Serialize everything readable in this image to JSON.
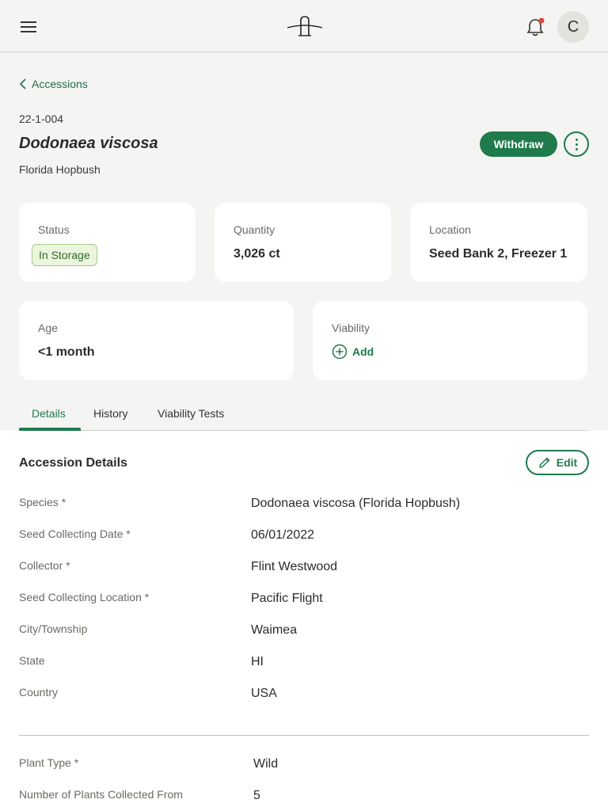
{
  "header": {
    "menu_icon": "hamburger-menu-icon",
    "logo_icon": "terraware-logo",
    "bell_icon": "notification-bell-icon",
    "notification_dot_color": "#e04a3a",
    "avatar_initial": "C"
  },
  "breadcrumb": {
    "label": "Accessions",
    "icon": "chevron-left-icon"
  },
  "accession": {
    "id": "22-1-004",
    "species": "Dodonaea viscosa",
    "common_name": "Florida Hopbush",
    "withdraw_label": "Withdraw",
    "more_icon": "vertical-dots-icon"
  },
  "cards": {
    "status": {
      "label": "Status",
      "value": "In Storage"
    },
    "quantity": {
      "label": "Quantity",
      "value": "3,026 ct"
    },
    "location": {
      "label": "Location",
      "value": "Seed Bank 2, Freezer 1"
    },
    "age": {
      "label": "Age",
      "value": "<1 month"
    },
    "viability": {
      "label": "Viability",
      "add_label": "Add",
      "add_icon": "plus-circle-icon"
    }
  },
  "tabs": [
    {
      "label": "Details",
      "active": true
    },
    {
      "label": "History",
      "active": false
    },
    {
      "label": "Viability Tests",
      "active": false
    }
  ],
  "details": {
    "title": "Accession Details",
    "edit_label": "Edit",
    "edit_icon": "pencil-icon",
    "fields": [
      {
        "label": "Species *",
        "value": "Dodonaea viscosa (Florida Hopbush)"
      },
      {
        "label": "Seed Collecting Date *",
        "value": "06/01/2022"
      },
      {
        "label": "Collector *",
        "value": "Flint Westwood"
      },
      {
        "label": "Seed Collecting Location *",
        "value": "Pacific Flight"
      },
      {
        "label": "City/Township",
        "value": "Waimea"
      },
      {
        "label": "State",
        "value": "HI"
      },
      {
        "label": "Country",
        "value": "USA"
      }
    ],
    "fields2": [
      {
        "label": "Plant Type *",
        "value": "Wild"
      },
      {
        "label": "Number of Plants Collected From",
        "value": "5"
      }
    ]
  },
  "colors": {
    "brand": "#1f7a4c",
    "background": "#f4f4f2"
  }
}
